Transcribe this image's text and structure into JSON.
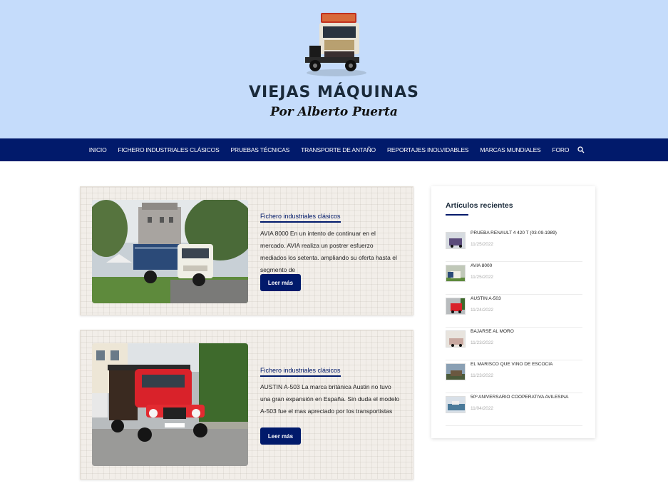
{
  "site": {
    "title": "VIEJAS MÁQUINAS",
    "subtitle": "Por Alberto Puerta",
    "logo_icon": "vintage-truck-logo",
    "header_bg": "#c5dcfb",
    "nav_bg": "#011a6b"
  },
  "nav": {
    "items": [
      "INICIO",
      "FICHERO INDUSTRIALES CLÁSICOS",
      "PRUEBAS TÉCNICAS",
      "TRANSPORTE DE ANTAÑO",
      "REPORTAJES INOLVIDABLES",
      "MARCAS MUNDIALES",
      "FORO"
    ],
    "search_icon": "search-icon"
  },
  "posts": [
    {
      "category": "Fichero industriales clásicos",
      "excerpt": "AVIA 8000 En un intento de continuar en el mercado. AVIA realiza un postrer esfuerzo mediados los setenta. ampliando su oferta hasta el segmento de",
      "button": "Leer más",
      "image": "white-avia-truck-photo"
    },
    {
      "category": "Fichero industriales clásicos",
      "excerpt": "AUSTIN A-503 La marca británica Austin no tuvo una gran expansión en España. Sin duda el modelo A-503 fue el mas apreciado por los transportistas",
      "button": "Leer más",
      "image": "red-austin-truck-photo"
    }
  ],
  "sidebar": {
    "title": "Artículos recientes",
    "items": [
      {
        "title": "PRUEBA RENAULT 4 420 T (03-09-1989)",
        "date": "11/25/2022"
      },
      {
        "title": "AVIA 8000",
        "date": "11/25/2022"
      },
      {
        "title": "AUSTIN A-503",
        "date": "11/24/2022"
      },
      {
        "title": "BAJARSE AL MORO",
        "date": "11/23/2022"
      },
      {
        "title": "EL MARISCO QUE VINO DE ESCOCIA",
        "date": "11/23/2022"
      },
      {
        "title": "50º ANIVERSARIO COOPERATIVA AVILESINA",
        "date": "11/04/2022"
      }
    ]
  }
}
